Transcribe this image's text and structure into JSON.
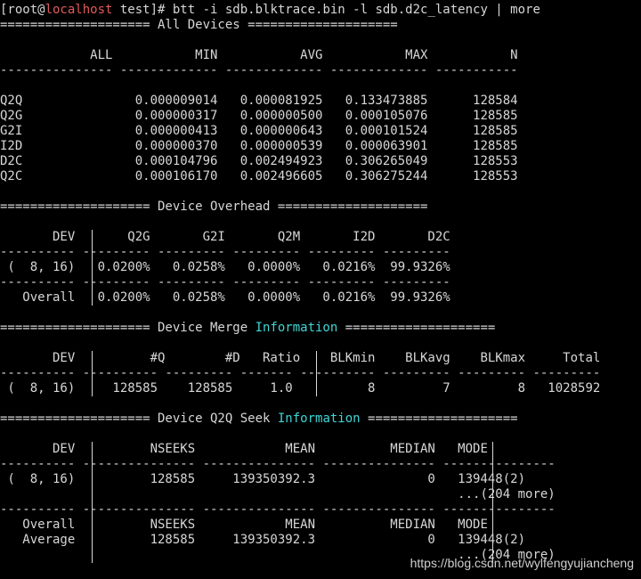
{
  "terminal": {
    "prompt_open": "[root@",
    "prompt_host": "localhost",
    "prompt_rest": " test]# ",
    "command": "btt -i sdb.blktrace.bin -l sdb.d2c_latency | more",
    "colors": {
      "background": "#000000",
      "text": "#d7d7d7",
      "highlight": "#3fd6d6",
      "host": "#e05a5a"
    }
  },
  "all_devices": {
    "header": "==================== All Devices ====================",
    "col_header": "            ALL           MIN           AVG           MAX           N",
    "separator": "--------------- ------------- ------------- ------------- -----------",
    "rows": [
      "Q2Q               0.000009014   0.000081925   0.133473885      128584",
      "Q2G               0.000000317   0.000000500   0.000105076      128585",
      "G2I               0.000000413   0.000000643   0.000101524      128585",
      "I2D               0.000000370   0.000000539   0.000063901      128585",
      "D2C               0.000104796   0.002494923   0.306265049      128553",
      "Q2C               0.000106170   0.002496605   0.306275244      128553"
    ]
  },
  "device_overhead": {
    "header": "==================== Device Overhead ====================",
    "col_header": "       DEV       Q2G       G2I       Q2M       I2D       D2C",
    "separator": "---------- --------- --------- --------- --------- ---------",
    "row": " (  8, 16)   0.0200%   0.0258%   0.0000%   0.0216%  99.9326%",
    "overall": "   Overall   0.0200%   0.0258%   0.0000%   0.0216%  99.9326%"
  },
  "device_merge": {
    "header_a": "==================== Device Merge ",
    "header_cyan": "Information",
    "header_b": " ====================",
    "col_header": "       DEV          #Q        #D   Ratio    BLKmin    BLKavg    BLKmax     Total",
    "separator": "---------- ---------- --------- ------- ---------- --------- --------- ---------",
    "row": " (  8, 16)     128585    128585     1.0          8         7         8   1028592"
  },
  "q2q_seek": {
    "header_a": "==================== Device Q2Q Seek ",
    "header_cyan": "Information",
    "header_b": " ====================",
    "col_header": "       DEV          NSEEKS            MEAN          MEDIAN   MODE",
    "separator": "---------- --------------- --------------- --------------- ---------------",
    "row1": " (  8, 16)          128585     139350392.3               0   139448(2)",
    "row2": "                                                             ...(204 more)",
    "separator2": "---------- --------------- --------------- --------------- ---------------",
    "overall1": "   Overall          NSEEKS            MEAN          MEDIAN   MODE",
    "overall2": "   Average          128585     139350392.3               0   139448(2)",
    "overall3": "                                                             ...(204 more)"
  },
  "watermark": "https://blog.csdn.net/wylfengyujiancheng"
}
